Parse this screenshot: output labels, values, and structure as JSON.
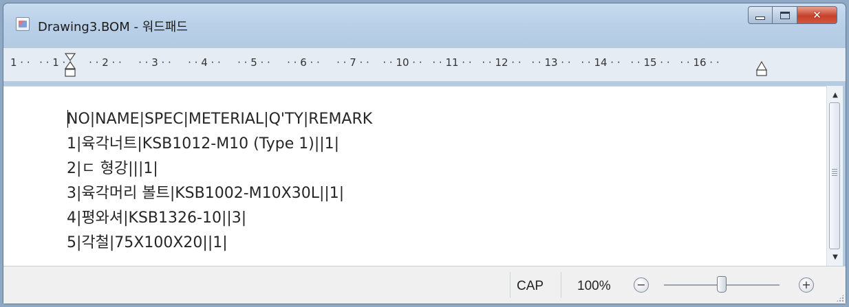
{
  "window": {
    "title": "Drawing3.BOM - 워드패드",
    "icon": "wordpad-app-icon"
  },
  "caption_buttons": {
    "minimize": "minimize-icon",
    "maximize": "maximize-icon",
    "close": "close-icon"
  },
  "ruler": {
    "numbers": [
      "1",
      "1",
      "2",
      "3",
      "4",
      "5",
      "6",
      "7",
      "10",
      "11",
      "12",
      "13",
      "14",
      "15",
      "16"
    ]
  },
  "document": {
    "lines": [
      "NO|NAME|SPEC|METERIAL|Q'TY|REMARK",
      "1|육각너트|KSB1012-M10 (Type 1)||1|",
      "2|ㄷ 형강|||1|",
      "3|육각머리 볼트|KSB1002-M10X30L||1|",
      "4|평와셔|KSB1326-10||3|",
      "5|각철|75X100X20||1|"
    ]
  },
  "status": {
    "caps": "CAP",
    "zoom_label": "100%",
    "zoom_out": "−",
    "zoom_in": "+",
    "zoom_level": 0.5
  },
  "colors": {
    "close_button": "#c7402a",
    "window_frame": "#b9d0e8"
  }
}
